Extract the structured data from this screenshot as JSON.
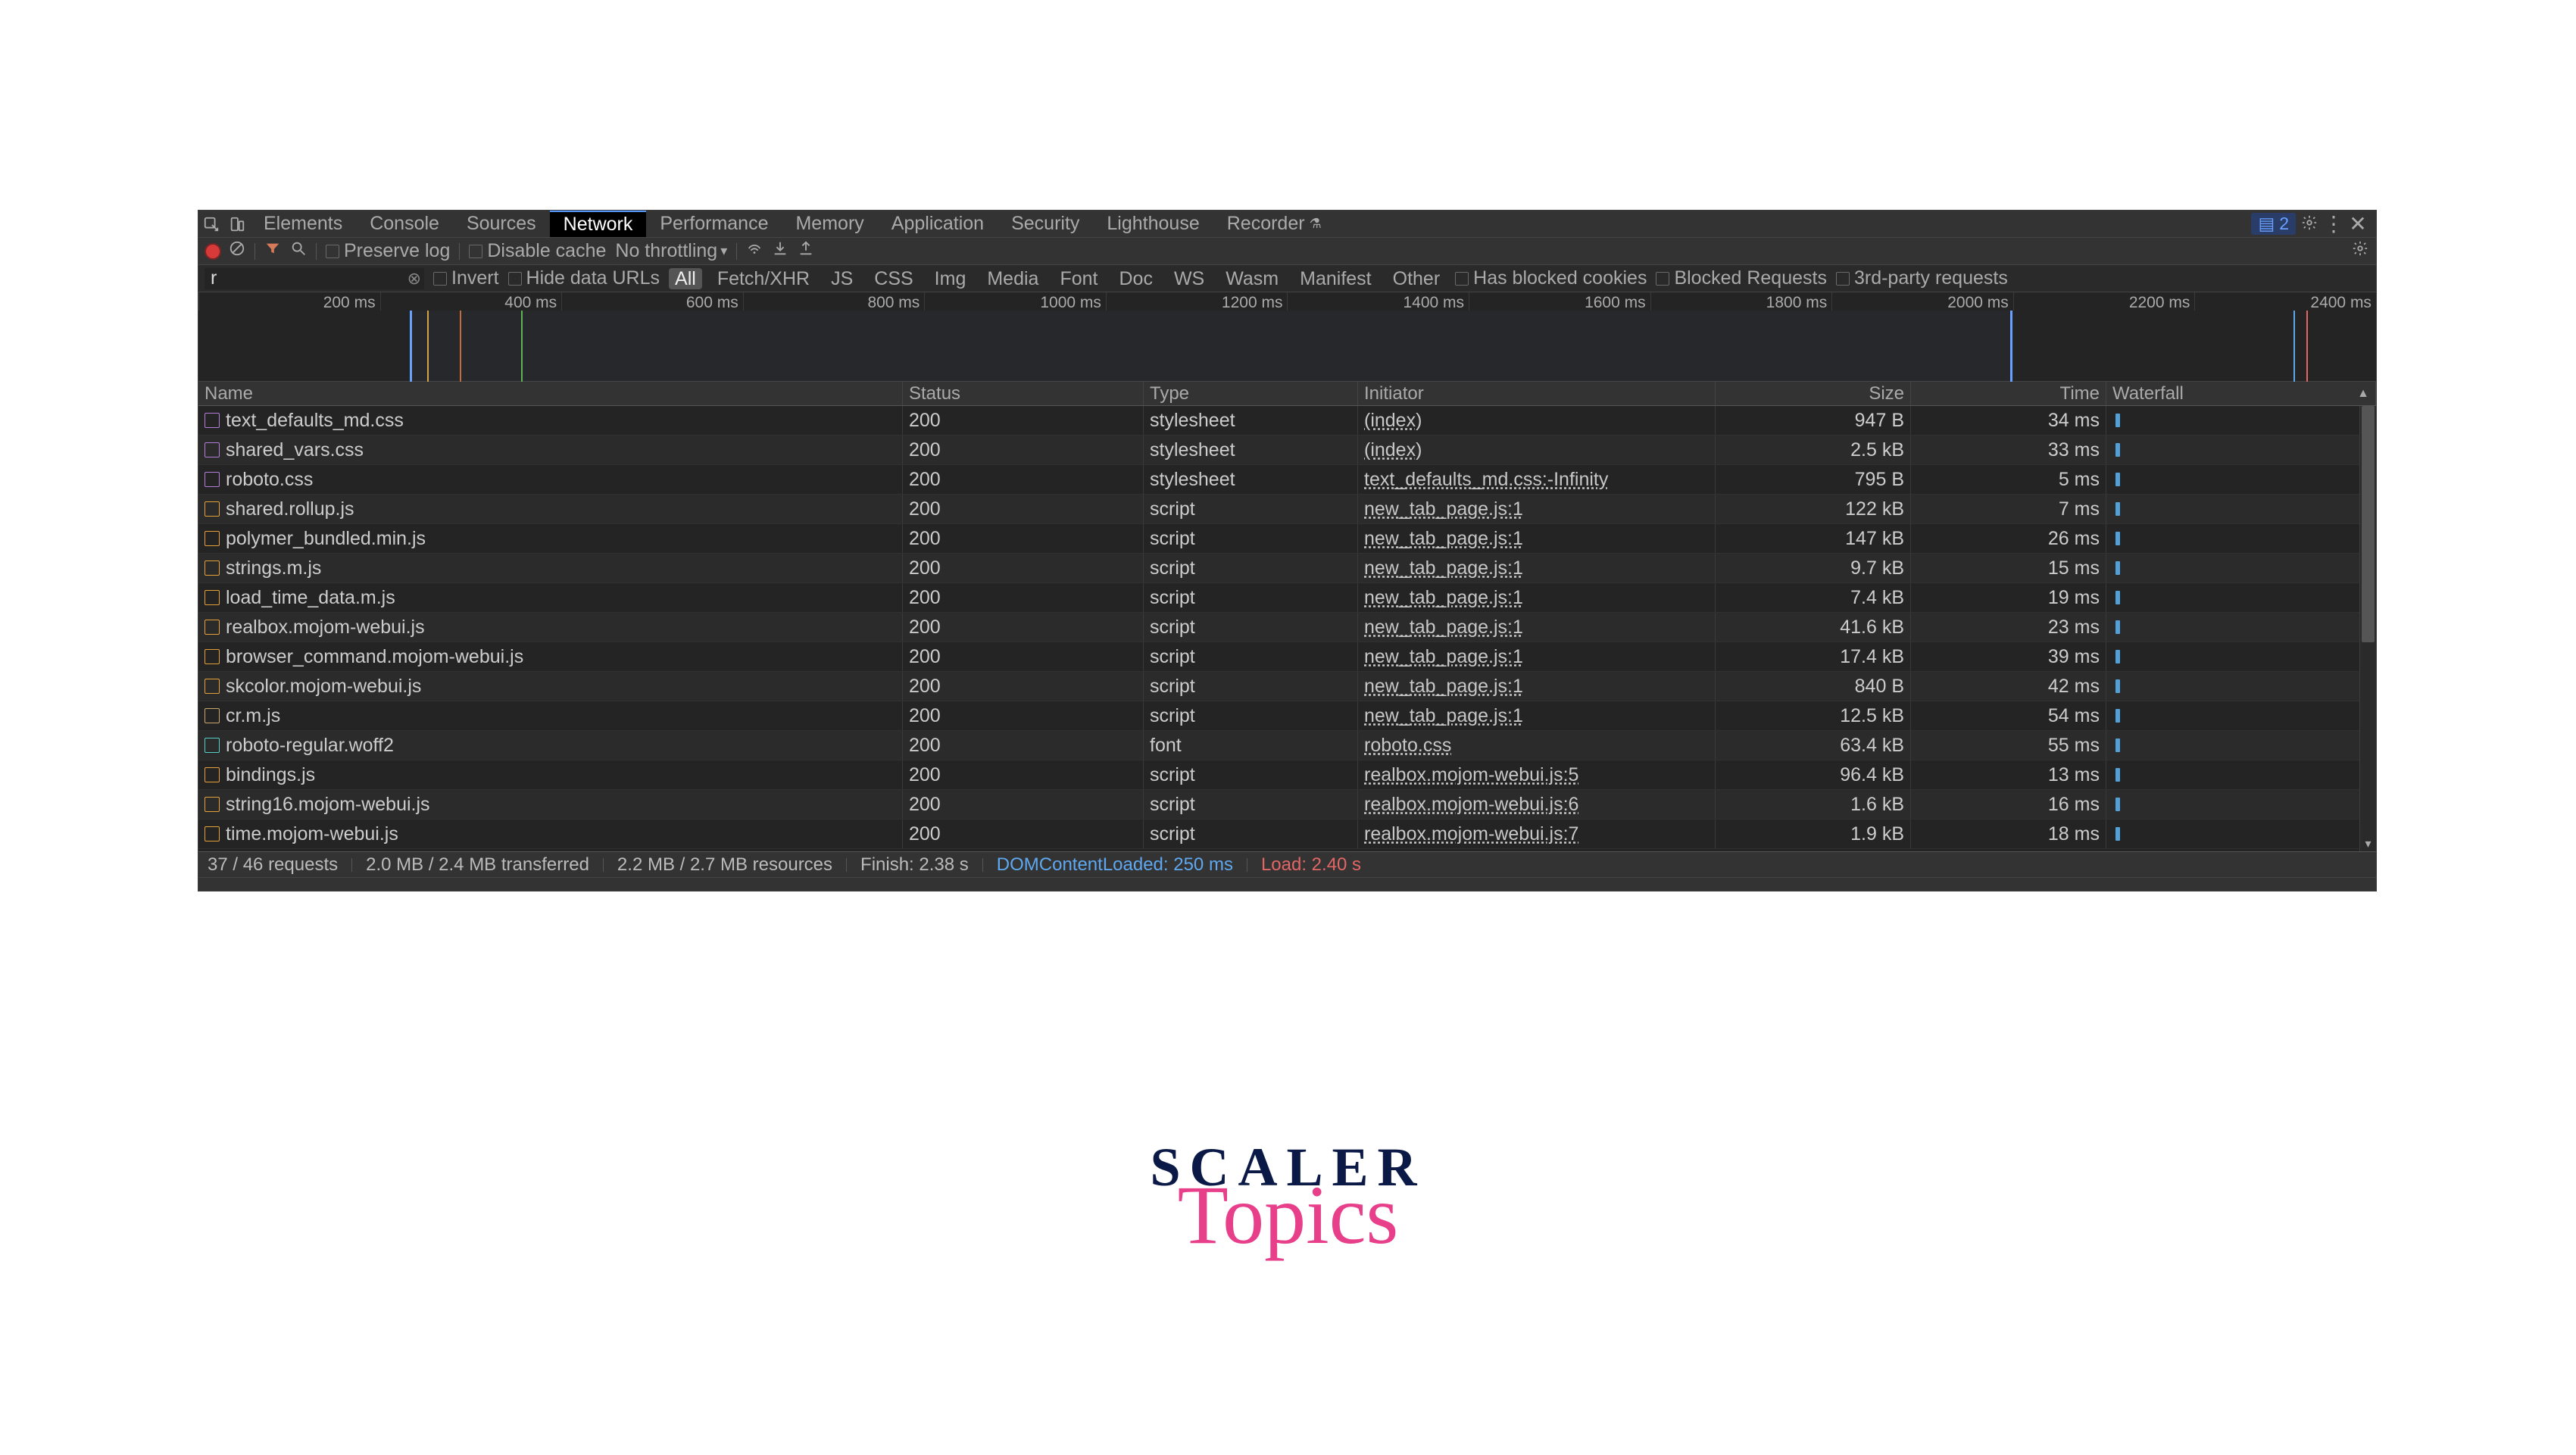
{
  "tabs": {
    "items": [
      "Elements",
      "Console",
      "Sources",
      "Network",
      "Performance",
      "Memory",
      "Application",
      "Security",
      "Lighthouse",
      "Recorder"
    ],
    "active": "Network",
    "issues_count": "2"
  },
  "toolbar": {
    "preserve_log": "Preserve log",
    "disable_cache": "Disable cache",
    "throttling": "No throttling"
  },
  "filters": {
    "input_value": "r",
    "invert": "Invert",
    "hide_data_urls": "Hide data URLs",
    "types": [
      "All",
      "Fetch/XHR",
      "JS",
      "CSS",
      "Img",
      "Media",
      "Font",
      "Doc",
      "WS",
      "Wasm",
      "Manifest",
      "Other"
    ],
    "active_type": "All",
    "has_blocked_cookies": "Has blocked cookies",
    "blocked_requests": "Blocked Requests",
    "third_party": "3rd-party requests"
  },
  "timeline": {
    "ticks": [
      "200 ms",
      "400 ms",
      "600 ms",
      "800 ms",
      "1000 ms",
      "1200 ms",
      "1400 ms",
      "1600 ms",
      "1800 ms",
      "2000 ms",
      "2200 ms",
      "2400 ms"
    ]
  },
  "columns": [
    "Name",
    "Status",
    "Type",
    "Initiator",
    "Size",
    "Time",
    "Waterfall"
  ],
  "rows": [
    {
      "name": "text_defaults_md.css",
      "status": "200",
      "type": "stylesheet",
      "initiator": "(index)",
      "size": "947 B",
      "time": "34 ms",
      "icon": "fi-purple"
    },
    {
      "name": "shared_vars.css",
      "status": "200",
      "type": "stylesheet",
      "initiator": "(index)",
      "size": "2.5 kB",
      "time": "33 ms",
      "icon": "fi-purple"
    },
    {
      "name": "roboto.css",
      "status": "200",
      "type": "stylesheet",
      "initiator": "text_defaults_md.css:-Infinity",
      "size": "795 B",
      "time": "5 ms",
      "icon": "fi-purple"
    },
    {
      "name": "shared.rollup.js",
      "status": "200",
      "type": "script",
      "initiator": "new_tab_page.js:1",
      "size": "122 kB",
      "time": "7 ms",
      "icon": "fi-orange"
    },
    {
      "name": "polymer_bundled.min.js",
      "status": "200",
      "type": "script",
      "initiator": "new_tab_page.js:1",
      "size": "147 kB",
      "time": "26 ms",
      "icon": "fi-orange"
    },
    {
      "name": "strings.m.js",
      "status": "200",
      "type": "script",
      "initiator": "new_tab_page.js:1",
      "size": "9.7 kB",
      "time": "15 ms",
      "icon": "fi-orange"
    },
    {
      "name": "load_time_data.m.js",
      "status": "200",
      "type": "script",
      "initiator": "new_tab_page.js:1",
      "size": "7.4 kB",
      "time": "19 ms",
      "icon": "fi-orange"
    },
    {
      "name": "realbox.mojom-webui.js",
      "status": "200",
      "type": "script",
      "initiator": "new_tab_page.js:1",
      "size": "41.6 kB",
      "time": "23 ms",
      "icon": "fi-orange"
    },
    {
      "name": "browser_command.mojom-webui.js",
      "status": "200",
      "type": "script",
      "initiator": "new_tab_page.js:1",
      "size": "17.4 kB",
      "time": "39 ms",
      "icon": "fi-orange"
    },
    {
      "name": "skcolor.mojom-webui.js",
      "status": "200",
      "type": "script",
      "initiator": "new_tab_page.js:1",
      "size": "840 B",
      "time": "42 ms",
      "icon": "fi-orange"
    },
    {
      "name": "cr.m.js",
      "status": "200",
      "type": "script",
      "initiator": "new_tab_page.js:1",
      "size": "12.5 kB",
      "time": "54 ms",
      "icon": "fi-tan"
    },
    {
      "name": "roboto-regular.woff2",
      "status": "200",
      "type": "font",
      "initiator": "roboto.css",
      "size": "63.4 kB",
      "time": "55 ms",
      "icon": "fi-teal"
    },
    {
      "name": "bindings.js",
      "status": "200",
      "type": "script",
      "initiator": "realbox.mojom-webui.js:5",
      "size": "96.4 kB",
      "time": "13 ms",
      "icon": "fi-orange"
    },
    {
      "name": "string16.mojom-webui.js",
      "status": "200",
      "type": "script",
      "initiator": "realbox.mojom-webui.js:6",
      "size": "1.6 kB",
      "time": "16 ms",
      "icon": "fi-orange"
    },
    {
      "name": "time.mojom-webui.js",
      "status": "200",
      "type": "script",
      "initiator": "realbox.mojom-webui.js:7",
      "size": "1.9 kB",
      "time": "18 ms",
      "icon": "fi-orange"
    }
  ],
  "status": {
    "requests": "37 / 46 requests",
    "transferred": "2.0 MB / 2.4 MB transferred",
    "resources": "2.2 MB / 2.7 MB resources",
    "finish": "Finish: 2.38 s",
    "dcl": "DOMContentLoaded: 250 ms",
    "load": "Load: 2.40 s"
  },
  "brand": {
    "line1": "SCALER",
    "line2": "Topics"
  }
}
